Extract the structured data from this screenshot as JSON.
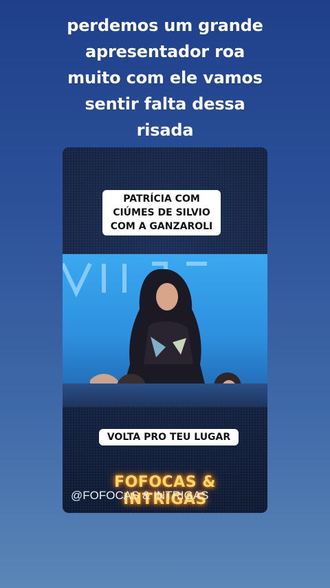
{
  "caption": {
    "lines": [
      "perdemos um grande",
      "apresentador roa",
      "muito com ele vamos",
      "sentir falta dessa",
      "risada"
    ]
  },
  "video": {
    "top_label_lines": [
      "PATRÍCIA COM",
      "CIÚMES DE SILVIO",
      "COM A GANZAROLI"
    ],
    "mid_label": "VOLTA PRO TEU LUGAR",
    "brand_text": "FOFOCAS & INTRIGAS",
    "handle_text": "@FOFOCAS & INTRIGAS"
  }
}
